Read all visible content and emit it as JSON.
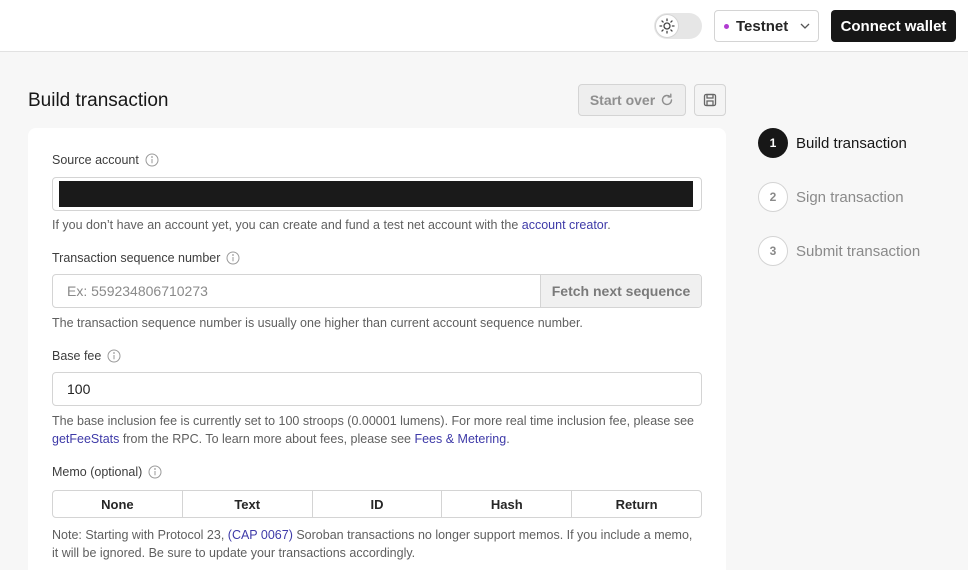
{
  "header": {
    "network_label": "Testnet",
    "connect_label": "Connect wallet",
    "colors": {
      "network_dot": "#b13bd1",
      "connect_bg": "#171717"
    }
  },
  "page": {
    "title": "Build transaction",
    "start_over_label": "Start over"
  },
  "form": {
    "source_account": {
      "label": "Source account",
      "value_redacted": true,
      "help_prefix": "If you don’t have an account yet, you can create and fund a test net account with the ",
      "help_link": "account creator",
      "help_suffix": "."
    },
    "sequence": {
      "label": "Transaction sequence number",
      "placeholder": "Ex: 559234806710273",
      "fetch_label": "Fetch next sequence",
      "help": "The transaction sequence number is usually one higher than current account sequence number."
    },
    "base_fee": {
      "label": "Base fee",
      "value": "100",
      "help_part1": "The base inclusion fee is currently set to 100 stroops (0.00001 lumens). For more real time inclusion fee, please see",
      "help_link1": "getFeeStats",
      "help_part2": " from the RPC. To learn more about fees, please see ",
      "help_link2": "Fees & Metering",
      "help_part3": "."
    },
    "memo": {
      "label": "Memo (optional)",
      "options": [
        "None",
        "Text",
        "ID",
        "Hash",
        "Return"
      ],
      "note_prefix": "Note: Starting with Protocol 23, ",
      "note_link": "(CAP 0067)",
      "note_suffix": " Soroban transactions no longer support memos. If you include a memo, it will be ignored. Be sure to update your transactions accordingly."
    }
  },
  "steps": [
    {
      "number": "1",
      "label": "Build transaction",
      "active": true
    },
    {
      "number": "2",
      "label": "Sign transaction",
      "active": false
    },
    {
      "number": "3",
      "label": "Submit transaction",
      "active": false
    }
  ]
}
